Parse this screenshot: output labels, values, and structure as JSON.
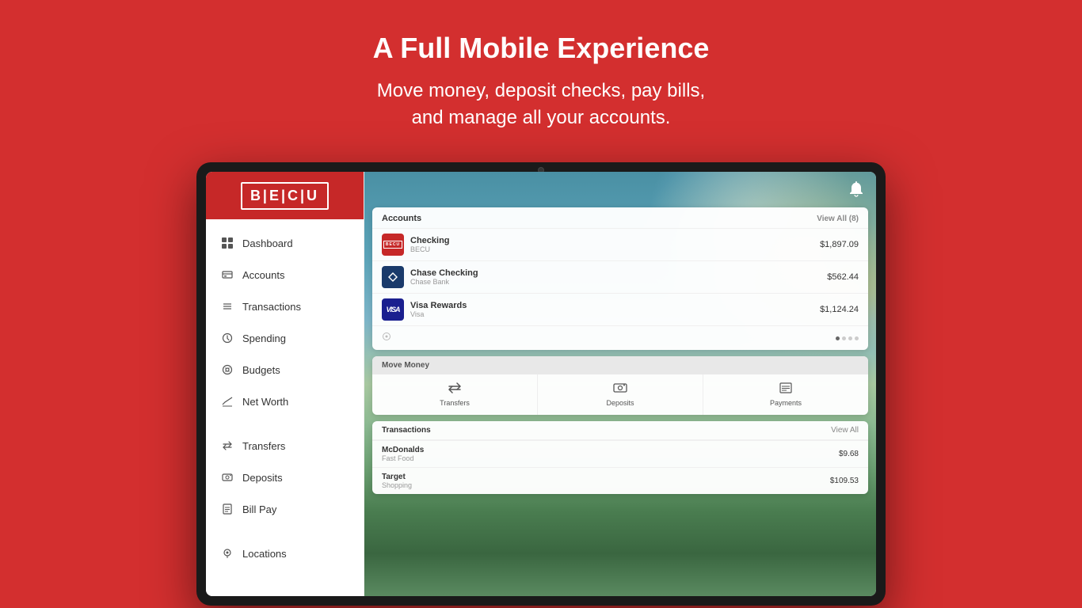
{
  "header": {
    "title": "A Full Mobile Experience",
    "subtitle_line1": "Move money, deposit checks, pay bills,",
    "subtitle_line2": "and manage all your accounts."
  },
  "tablet": {
    "camera_label": "front-camera"
  },
  "sidebar": {
    "logo_text": "B|E|C|U",
    "nav_items": [
      {
        "id": "dashboard",
        "label": "Dashboard",
        "icon": "⊞"
      },
      {
        "id": "accounts",
        "label": "Accounts",
        "icon": "🏛"
      },
      {
        "id": "transactions",
        "label": "Transactions",
        "icon": "☰"
      },
      {
        "id": "spending",
        "label": "Spending",
        "icon": "↺"
      },
      {
        "id": "budgets",
        "label": "Budgets",
        "icon": "⚙"
      },
      {
        "id": "net-worth",
        "label": "Net Worth",
        "icon": "📈"
      }
    ],
    "nav_items_bottom": [
      {
        "id": "transfers",
        "label": "Transfers",
        "icon": "⇄"
      },
      {
        "id": "deposits",
        "label": "Deposits",
        "icon": "📷"
      },
      {
        "id": "bill-pay",
        "label": "Bill Pay",
        "icon": "📄"
      }
    ],
    "nav_items_extra": [
      {
        "id": "locations",
        "label": "Locations",
        "icon": "◎"
      }
    ]
  },
  "accounts_section": {
    "title": "Accounts",
    "view_all_label": "View All  (8)",
    "accounts": [
      {
        "id": "checking-becu",
        "name": "Checking",
        "bank": "BECU",
        "amount": "$1,897.09",
        "logo_type": "becu"
      },
      {
        "id": "chase-checking",
        "name": "Chase Checking",
        "bank": "Chase Bank",
        "amount": "$562.44",
        "logo_type": "chase"
      },
      {
        "id": "visa-rewards",
        "name": "Visa Rewards",
        "bank": "Visa",
        "amount": "$1,124.24",
        "logo_type": "visa"
      }
    ],
    "dots": 4,
    "active_dot": 0
  },
  "move_money": {
    "title": "Move Money",
    "actions": [
      {
        "id": "transfers",
        "label": "Transfers",
        "icon": "⇄"
      },
      {
        "id": "deposits",
        "label": "Deposits",
        "icon": "📷"
      },
      {
        "id": "payments",
        "label": "Payments",
        "icon": "📋"
      }
    ]
  },
  "transactions_section": {
    "title": "Transactions",
    "view_all_label": "View All",
    "transactions": [
      {
        "id": "mcdonalds",
        "name": "McDonalds",
        "category": "Fast Food",
        "amount": "$9.68"
      },
      {
        "id": "target",
        "name": "Target",
        "category": "Shopping",
        "amount": "$109.53"
      }
    ]
  },
  "bell_icon": "🔔",
  "colors": {
    "brand_red": "#c62828",
    "bg_red": "#d32f2f"
  }
}
